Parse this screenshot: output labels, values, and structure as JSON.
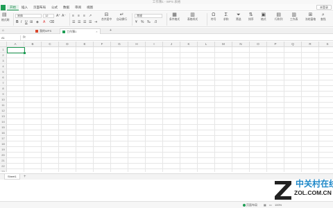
{
  "window": {
    "title": "工作簿1 - WPS 表格"
  },
  "menubar": {
    "tabs": [
      "开始",
      "插入",
      "页面布局",
      "公式",
      "数据",
      "审阅",
      "视图"
    ],
    "active_index": 0,
    "unsaved_label": "未登录"
  },
  "ribbon": {
    "format_painter": "格式刷",
    "font_name": "宋体",
    "font_size": "12",
    "merge": "合并居中",
    "wrap": "自动换行",
    "number_format": "常规",
    "cond_format": "条件格式",
    "table_style": "表格样式",
    "symbol": "符号",
    "sum": "求和",
    "filter": "筛选",
    "sort": "排序",
    "format": "格式",
    "rows_cols": "行和列",
    "worksheet": "工作表",
    "freeze": "冻结窗格",
    "find": "查找"
  },
  "tabs": {
    "wps_home": "我的WPS",
    "workbook": "工作簿1"
  },
  "formula": {
    "cell_ref": "A1",
    "fx_label": "fx"
  },
  "columns": [
    "A",
    "B",
    "C",
    "D",
    "E",
    "F",
    "G",
    "H",
    "I",
    "J",
    "K",
    "L",
    "M",
    "N",
    "O",
    "P",
    "Q",
    "R",
    "S"
  ],
  "rows": [
    "1",
    "2",
    "3",
    "4",
    "5",
    "6",
    "7",
    "8",
    "9",
    "10",
    "11",
    "12",
    "13",
    "14",
    "15",
    "16",
    "17",
    "18",
    "19",
    "20",
    "21",
    "22",
    "23"
  ],
  "sheets": {
    "active": "Sheet1",
    "add_label": "+"
  },
  "statusbar": {
    "paper_mode": "页面布局",
    "zoom": "100%"
  },
  "watermark": {
    "cn": "中关村在线",
    "en": "ZOL.COM.CN"
  },
  "colors": {
    "accent": "#1f9d55",
    "brand_blue": "#1e88c8"
  }
}
